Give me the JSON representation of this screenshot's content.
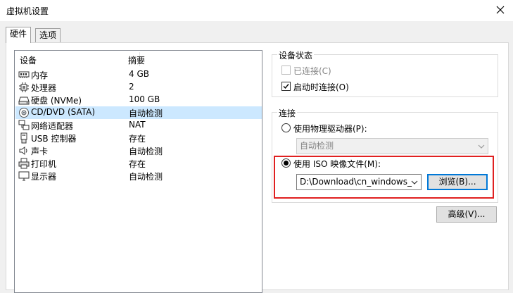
{
  "window": {
    "title": "虚拟机设置"
  },
  "tabs": [
    {
      "label": "硬件"
    },
    {
      "label": "选项"
    }
  ],
  "device_list": {
    "headers": {
      "device": "设备",
      "summary": "摘要"
    },
    "rows": [
      {
        "icon": "memory-icon",
        "name": "内存",
        "summary": "4 GB"
      },
      {
        "icon": "processor-icon",
        "name": "处理器",
        "summary": "2"
      },
      {
        "icon": "hard-disk-icon",
        "name": "硬盘 (NVMe)",
        "summary": "100 GB"
      },
      {
        "icon": "cd-dvd-icon",
        "name": "CD/DVD (SATA)",
        "summary": "自动检测"
      },
      {
        "icon": "network-adapter-icon",
        "name": "网络适配器",
        "summary": "NAT"
      },
      {
        "icon": "usb-icon",
        "name": "USB 控制器",
        "summary": "存在"
      },
      {
        "icon": "sound-card-icon",
        "name": "声卡",
        "summary": "自动检测"
      },
      {
        "icon": "printer-icon",
        "name": "打印机",
        "summary": "存在"
      },
      {
        "icon": "display-icon",
        "name": "显示器",
        "summary": "自动检测"
      }
    ],
    "selected_index": 3
  },
  "device_status": {
    "title": "设备状态",
    "connected": {
      "label": "已连接(C)",
      "checked": false,
      "disabled": true
    },
    "connect_at_power_on": {
      "label": "启动时连接(O)",
      "checked": true
    }
  },
  "connection": {
    "title": "连接",
    "physical_drive": {
      "label": "使用物理驱动器(P):",
      "selected": false,
      "select_value": "自动检测"
    },
    "iso_image": {
      "label": "使用 ISO 映像文件(M):",
      "selected": true,
      "path_value": "D:\\Download\\cn_windows_s"
    },
    "browse_button": "浏览(B)...",
    "advanced_button": "高级(V)..."
  },
  "colors": {
    "selection": "#cce8ff",
    "highlight_border": "#e02020",
    "focus_border": "#0078d7"
  }
}
